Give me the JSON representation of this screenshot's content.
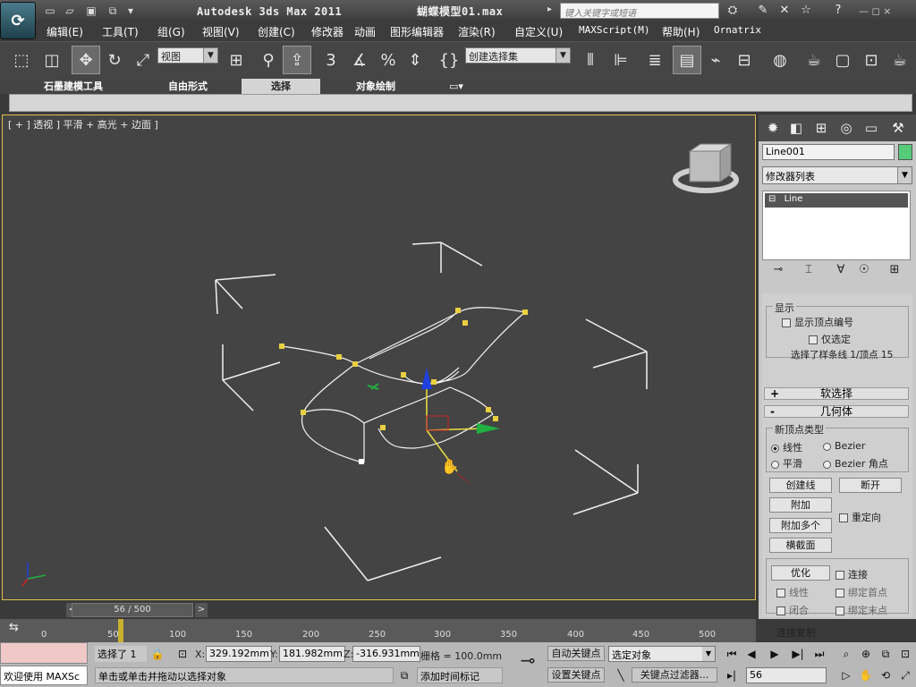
{
  "title": {
    "app": "Autodesk 3ds Max  2011",
    "file": "蝴蝶模型01.max",
    "search_placeholder": "键入关键字或短语",
    "window_controls": "— ◻ ×"
  },
  "menu": [
    "编辑(E)",
    "工具(T)",
    "组(G)",
    "视图(V)",
    "创建(C)",
    "修改器",
    "动画",
    "图形编辑器",
    "渲染(R)",
    "自定义(U)",
    "MAXScript(M)",
    "帮助(H)",
    "Ornatrix"
  ],
  "toolbar": {
    "view_combo": "视图",
    "snap_label": "3",
    "selection_set": "创建选择集"
  },
  "ribbon_tabs": [
    "石墨建模工具",
    "自由形式",
    "选择",
    "对象绘制"
  ],
  "ribbon_active": "选择",
  "viewport": {
    "label": "[ + ] 透视 ] 平滑 + 高光 + 边面 ]"
  },
  "panel": {
    "object_name": "Line001",
    "object_color": "#55cc7a",
    "modifier_list": "修改器列表",
    "stack_item": "Line",
    "display_header": "显示",
    "show_vertex_numbers": "显示顶点编号",
    "selected_only": "仅选定",
    "selection_status": "选择了样条线 1/顶点 15",
    "soft_selection": "软选择",
    "geometry": "几何体",
    "new_vertex_type": "新顶点类型",
    "vt_linear": "线性",
    "vt_bezier": "Bezier",
    "vt_smooth": "平滑",
    "vt_bezier_corner": "Bezier 角点",
    "create_line": "创建线",
    "break": "断开",
    "attach": "附加",
    "reorient": "重定向",
    "attach_multiple": "附加多个",
    "cross_section": "横截面",
    "optimize": "优化",
    "connect": "连接",
    "linear": "线性",
    "bind_first": "绑定首点",
    "closed": "闭合",
    "bind_last": "绑定末点",
    "connect_copy": "连接复制"
  },
  "timeline": {
    "frame_display": "56 / 500",
    "prev": "<",
    "next": ">",
    "ticks": [
      "0",
      "50",
      "100",
      "150",
      "200",
      "250",
      "300",
      "350",
      "400",
      "450",
      "500"
    ]
  },
  "status": {
    "welcome": "欢迎使用 MAXSc",
    "selected": "选择了 1",
    "x_label": "X:",
    "x_value": "329.192mm",
    "y_label": "Y:",
    "y_value": "181.982mm",
    "z_label": "Z:",
    "z_value": "-316.931mm",
    "grid": "栅格 = 100.0mm",
    "prompt": "单击或单击并拖动以选择对象",
    "add_time_tag": "添加时间标记",
    "auto_key": "自动关键点",
    "set_key": "设置关键点",
    "selected_object": "选定对象",
    "key_filters": "关键点过滤器...",
    "current_frame": "56"
  },
  "colors": {
    "viewport_bg": "#444444",
    "viewport_border": "#e0c050",
    "spline": "#ffffff",
    "vertex": "#e8d040",
    "axis_x": "#d02020",
    "axis_y": "#20b040",
    "axis_z": "#2040e0"
  }
}
